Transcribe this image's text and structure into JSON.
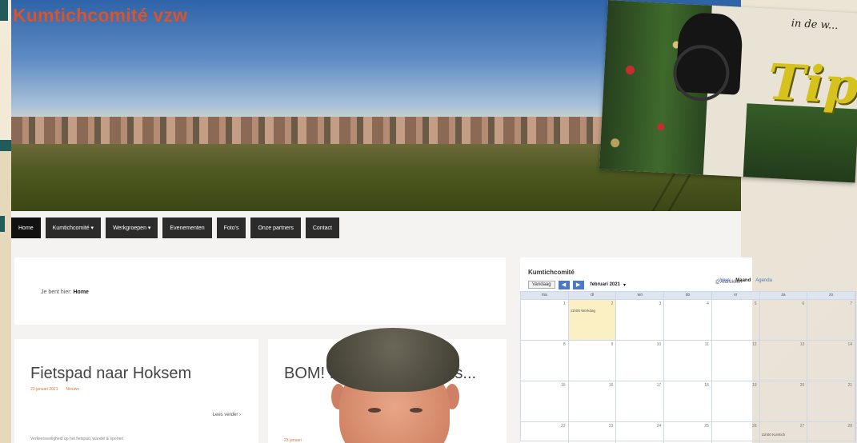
{
  "site": {
    "title": "Kumtichcomité vzw",
    "logo_letter": "K"
  },
  "nav": {
    "items": [
      {
        "label": "Home",
        "active": true
      },
      {
        "label": "Kumtichcomité ▾",
        "active": false
      },
      {
        "label": "Werkgroepen ▾",
        "active": false
      },
      {
        "label": "Evenementen",
        "active": false
      },
      {
        "label": "Foto's",
        "active": false
      },
      {
        "label": "Onze partners",
        "active": false
      },
      {
        "label": "Contact",
        "active": false
      }
    ]
  },
  "breadcrumb": {
    "prefix": "Je bent hier:",
    "current": "Home"
  },
  "posts": [
    {
      "title": "Fietspad naar Hoksem",
      "date": "23 januari 2021",
      "category": "Nieuws",
      "readmore": "Lees verder ›",
      "excerpt": "Verkeersveiligheid op het fietspad, wandel & sporten"
    },
    {
      "title": "BOM! ...ie voor E... Mens...",
      "date": "23 januari",
      "category": "",
      "readmore": "",
      "excerpt": ""
    }
  ],
  "calendar": {
    "title": "Kumtichcomité",
    "today_label": "Vandaag",
    "prev": "◀",
    "next": "▶",
    "month": "februari 2021",
    "month_caret": "▾",
    "print_label": "Afdrukken",
    "views": [
      "Week",
      "Maand",
      "Agenda"
    ],
    "active_view": "Maand",
    "weekdays": [
      "ma",
      "di",
      "wo",
      "do",
      "vr",
      "za",
      "zo"
    ],
    "weeks": [
      [
        "1",
        "2",
        "3",
        "4",
        "5",
        "6",
        "7"
      ],
      [
        "8",
        "9",
        "10",
        "11",
        "12",
        "13",
        "14"
      ],
      [
        "15",
        "16",
        "17",
        "18",
        "19",
        "20",
        "21"
      ],
      [
        "22",
        "23",
        "24",
        "25",
        "26",
        "27",
        "28"
      ]
    ],
    "today_index": [
      0,
      1
    ],
    "event": "11h00 Werkdag",
    "event2": "11h00 Kumtich"
  },
  "flyer": {
    "script_text": "in de w...",
    "big_text": "Tip"
  },
  "colors": {
    "title": "#d8542c",
    "nav_bg": "#2b2b2b",
    "meta": "#e0753f",
    "cal_accent": "#4a79c6",
    "teal": "#1f5c5a"
  }
}
